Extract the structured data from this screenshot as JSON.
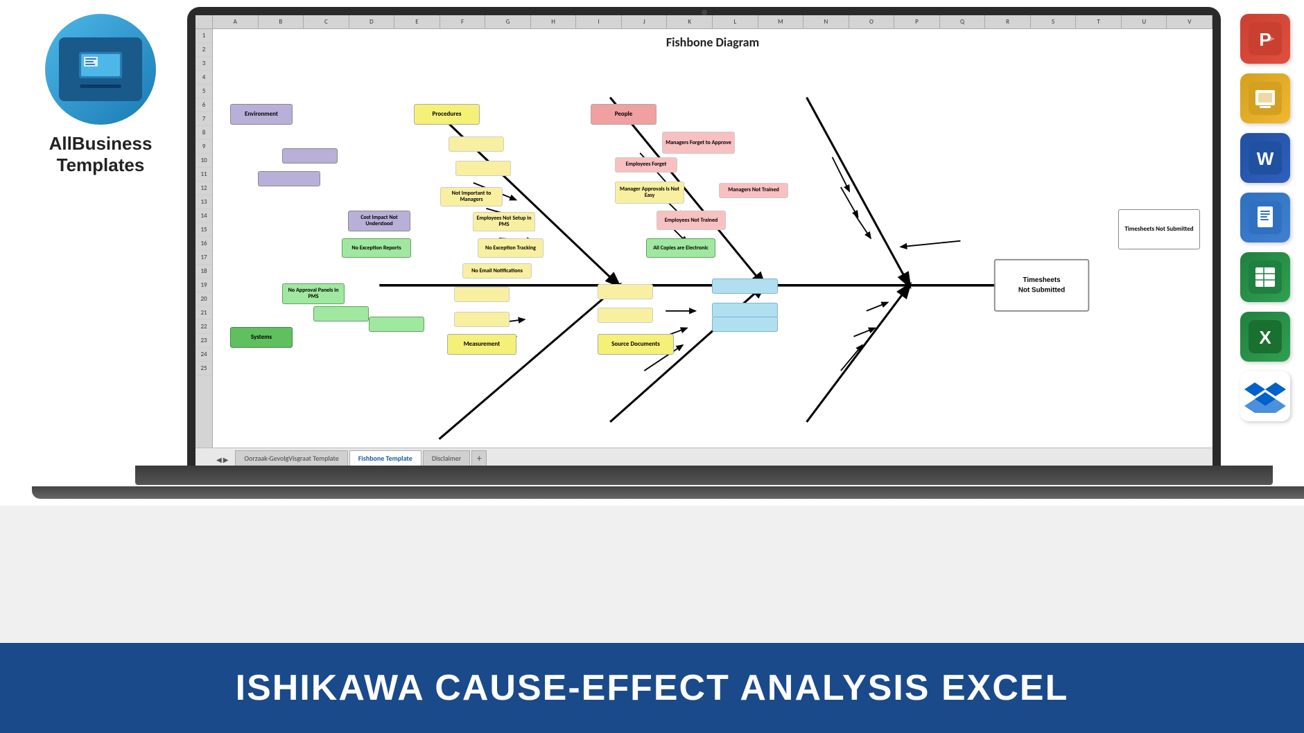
{
  "logo": {
    "title_line1": "AllBusiness",
    "title_line2": "Templates"
  },
  "banner": {
    "text": "ISHIKAWA CAUSE-EFFECT ANALYSIS  EXCEL"
  },
  "diagram": {
    "title": "Fishbone Diagram",
    "categories": {
      "environment": "Environment",
      "procedures": "Procedures",
      "people": "People",
      "systems": "Systems",
      "measurement": "Measurement",
      "source_documents": "Source Documents"
    },
    "boxes": {
      "managers_forget_approve": "Managers Forget to Approve",
      "employees_forget": "Employees Forget",
      "managers_not_trained": "Managers Not Trained",
      "manager_approvals_not_easy": "Manager Approvals is Not Easy",
      "employees_not_trained": "Employees Not Trained",
      "timesheets_not_submitted": "Timesheets Not Submitted",
      "cost_impact_not_understood": "Cost Impact Not Understood",
      "employees_not_setup_pms": "Employees Not Setup in PMS",
      "not_important_to_managers": "Not Important to Managers",
      "no_exception_reports": "No Exception Reports",
      "no_exception_tracking": "No Exception Tracking",
      "all_copies_electronic": "All Copies are Electronic",
      "no_email_notifications": "No Email Notifications",
      "no_approval_panels_pms": "No Approval Panels in PMS"
    }
  },
  "tabs": {
    "tab1": "Oorzaak-GevolgVisgraat Template",
    "tab2": "Fishbone Template",
    "tab3": "Disclaimer",
    "add_label": "+"
  },
  "columns": [
    "A",
    "B",
    "C",
    "D",
    "E",
    "F",
    "G",
    "H",
    "I",
    "J",
    "K",
    "L",
    "M",
    "N",
    "O",
    "P",
    "Q",
    "R",
    "S",
    "T",
    "U",
    "V"
  ],
  "right_icons": {
    "powerpoint": "P",
    "slides": "G",
    "word": "W",
    "docs": "D",
    "sheets": "S",
    "excel": "X"
  }
}
